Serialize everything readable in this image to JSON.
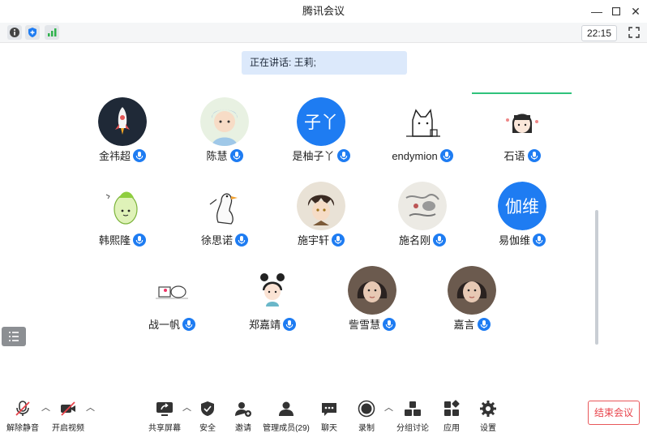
{
  "window": {
    "title": "腾讯会议"
  },
  "toolbar": {
    "time": "22:15"
  },
  "speaking": {
    "text": "正在讲话: 王莉;"
  },
  "participants": [
    {
      "name": "金祎超",
      "avatar": "rocket-avatar"
    },
    {
      "name": "陈慧",
      "avatar": "cartoon-boy-avatar"
    },
    {
      "name": "是柚子丫",
      "avatar": "text-avatar",
      "avatar_text": "子丫",
      "avatar_color": "#1e7cf2"
    },
    {
      "name": "endymion",
      "avatar": "sketch-cat-avatar"
    },
    {
      "name": "石语",
      "avatar": "cartoon-girl-avatar"
    },
    {
      "name": "韩熙隆",
      "avatar": "cabbage-avatar"
    },
    {
      "name": "徐思诺",
      "avatar": "goose-avatar"
    },
    {
      "name": "施宇轩",
      "avatar": "anime-avatar"
    },
    {
      "name": "施名刚",
      "avatar": "art-avatar"
    },
    {
      "name": "易伽维",
      "avatar": "text-avatar",
      "avatar_text": "伽维",
      "avatar_color": "#1e7cf2"
    },
    {
      "name": "战一帆",
      "avatar": "sketch-avatar"
    },
    {
      "name": "郑嘉靖",
      "avatar": "bun-girl-avatar"
    },
    {
      "name": "訾雪慧",
      "avatar": "photo-avatar"
    },
    {
      "name": "嘉言",
      "avatar": "photo-avatar"
    }
  ],
  "bottom": {
    "unmute": "解除静音",
    "video": "开启视频",
    "share": "共享屏幕",
    "security": "安全",
    "invite": "邀请",
    "members": "管理成员(29)",
    "chat": "聊天",
    "record": "录制",
    "breakout": "分组讨论",
    "apps": "应用",
    "settings": "设置",
    "end": "结束会议"
  },
  "colors": {
    "accent": "#1e7cf2",
    "end": "#e8434b",
    "active_line": "#2fc27b"
  }
}
